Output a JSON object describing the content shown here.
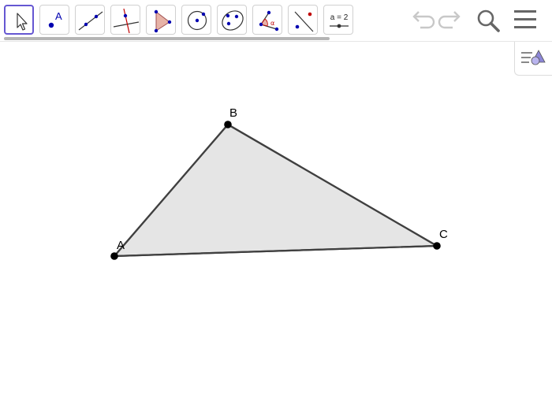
{
  "toolbar": {
    "tools": [
      {
        "name": "move-tool",
        "icon": "cursor-arrow-icon",
        "active": true
      },
      {
        "name": "point-tool",
        "icon": "point-icon",
        "label": "A"
      },
      {
        "name": "line-tool",
        "icon": "line-icon"
      },
      {
        "name": "perpendicular-tool",
        "icon": "perpendicular-line-icon"
      },
      {
        "name": "polygon-tool",
        "icon": "polygon-icon"
      },
      {
        "name": "circle-tool",
        "icon": "circle-icon"
      },
      {
        "name": "ellipse-tool",
        "icon": "ellipse-icon"
      },
      {
        "name": "angle-tool",
        "icon": "angle-icon",
        "label": "α"
      },
      {
        "name": "reflect-tool",
        "icon": "reflect-icon"
      },
      {
        "name": "slider-tool",
        "icon": "slider-icon",
        "label": "a = 2"
      }
    ],
    "actions": {
      "undo": "undo-icon",
      "redo": "redo-icon",
      "search": "search-icon",
      "menu": "hamburger-menu-icon"
    }
  },
  "style_bar": {
    "icon": "style-bar-icon"
  },
  "construction": {
    "points": {
      "A": "A",
      "B": "B",
      "C": "C"
    },
    "fill_color": "#e5e5e5",
    "stroke_color": "#404040"
  },
  "colors": {
    "accent": "#6557d2",
    "point_blue": "#0000b0",
    "icon_red": "#c00000"
  }
}
